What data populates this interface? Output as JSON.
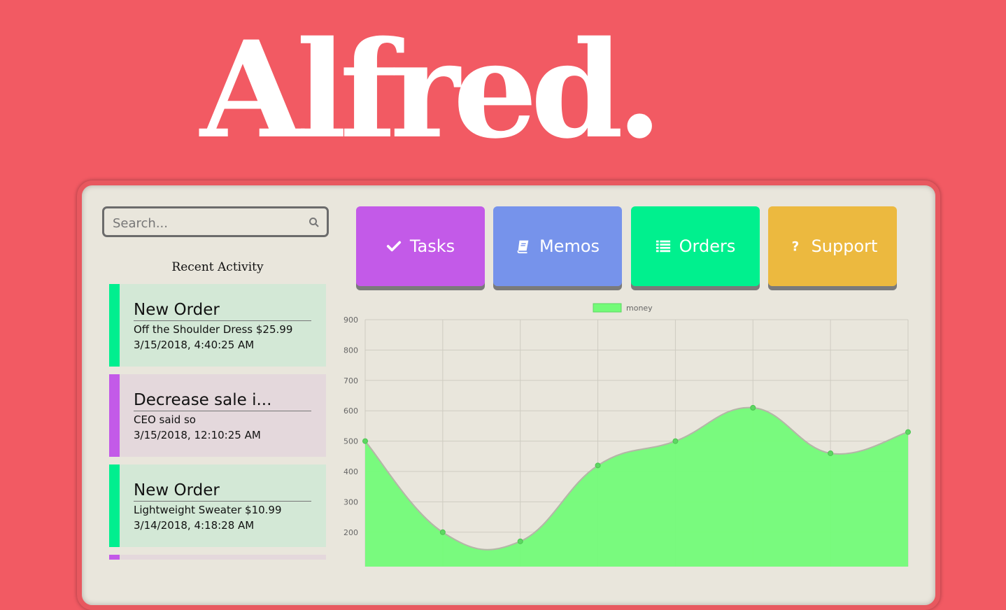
{
  "brand": {
    "title": "Alfred."
  },
  "search": {
    "placeholder": "Search..."
  },
  "recent": {
    "heading": "Recent Activity",
    "items": [
      {
        "title": "New Order",
        "line1": "Off the Shoulder Dress $25.99",
        "line2": "3/15/2018, 4:40:25 AM",
        "accent": "#00ef8f",
        "bg": "#d3e8d6"
      },
      {
        "title": "Decrease sale i...",
        "line1": "CEO said so",
        "line2": "3/15/2018, 12:10:25 AM",
        "accent": "#c35ae8",
        "bg": "#e4d8dc"
      },
      {
        "title": "New Order",
        "line1": "Lightweight Sweater $10.99",
        "line2": "3/14/2018, 4:18:28 AM",
        "accent": "#00ef8f",
        "bg": "#d3e8d6"
      },
      {
        "title": "",
        "line1": "",
        "line2": "",
        "accent": "#c35ae8",
        "bg": "#e4d8dc"
      }
    ]
  },
  "nav": {
    "tasks": {
      "label": "Tasks",
      "color": "#c35ae8",
      "icon": "check-icon"
    },
    "memos": {
      "label": "Memos",
      "color": "#7693eb",
      "icon": "book-icon"
    },
    "orders": {
      "label": "Orders",
      "color": "#00f08e",
      "icon": "list-icon"
    },
    "support": {
      "label": "Support",
      "color": "#ecb93f",
      "icon": "question-icon"
    }
  },
  "chart_data": {
    "type": "area",
    "series": [
      {
        "name": "money",
        "color": "#73fb78",
        "values": [
          500,
          200,
          170,
          420,
          500,
          610,
          460,
          530
        ]
      }
    ],
    "x": [
      0,
      1,
      2,
      3,
      4,
      5,
      6,
      7
    ],
    "yticks": [
      200,
      300,
      400,
      500,
      600,
      700,
      800,
      900
    ],
    "ylim": [
      100,
      900
    ],
    "legend": "top-center",
    "grid": true
  }
}
